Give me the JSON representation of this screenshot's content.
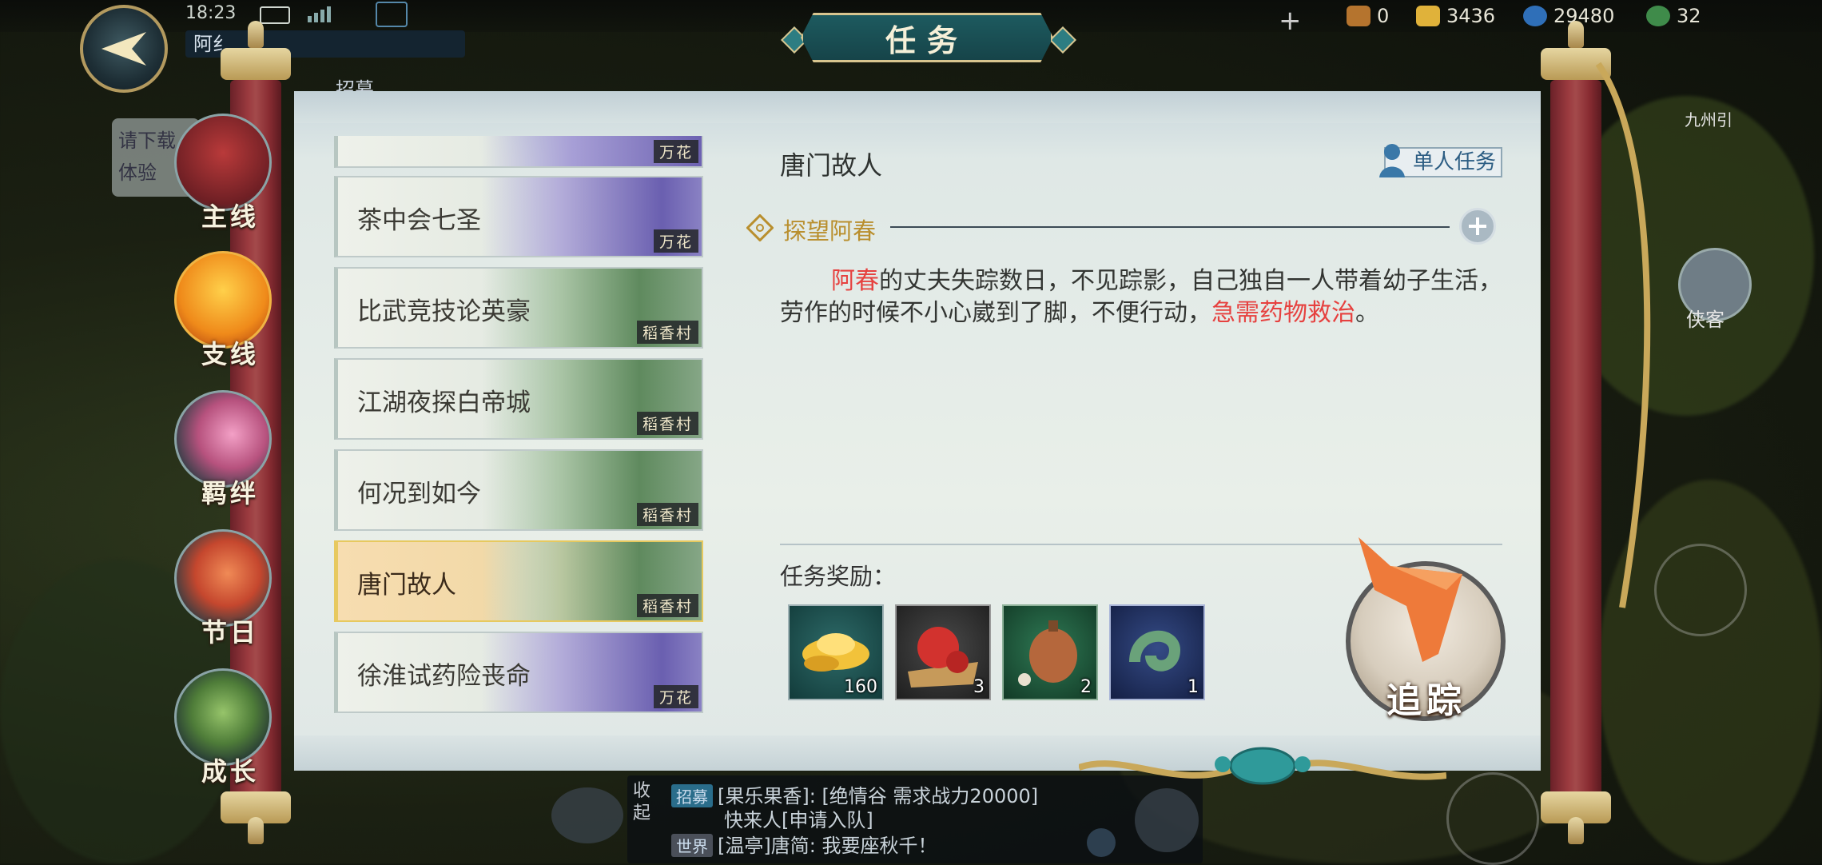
{
  "status_bar": {
    "time": "18:23",
    "battery_level": "30"
  },
  "top_resources": {
    "gold": "3436",
    "coins": "29480",
    "jade_partial": "32",
    "other": "0"
  },
  "player_name_partial": "阿纟",
  "tip_text": [
    "请下载",
    "体验"
  ],
  "recruit_label": "招募",
  "panel_title": "任务",
  "categories": [
    {
      "label": "主线",
      "active": false
    },
    {
      "label": "支线",
      "active": true
    },
    {
      "label": "羁绊",
      "active": false
    },
    {
      "label": "节日",
      "active": false
    },
    {
      "label": "成长",
      "active": false
    }
  ],
  "quests": [
    {
      "title": "",
      "location": "万花",
      "scene": "purple"
    },
    {
      "title": "茶中会七圣",
      "location": "万花",
      "scene": "purple"
    },
    {
      "title": "比武竞技论英豪",
      "location": "稻香村",
      "scene": "green"
    },
    {
      "title": "江湖夜探白帝城",
      "location": "稻香村",
      "scene": "green"
    },
    {
      "title": "何况到如今",
      "location": "稻香村",
      "scene": "green"
    },
    {
      "title": "唐门故人",
      "location": "稻香村",
      "scene": "green",
      "active": true
    },
    {
      "title": "徐淮试药险丧命",
      "location": "万花",
      "scene": "purple"
    }
  ],
  "detail": {
    "title": "唐门故人",
    "badge": "单人任务",
    "objective": "探望阿春",
    "desc_name": "阿春",
    "desc_mid": "的丈夫失踪数日，不见踪影，自己独自一人带着幼子生活，劳作的时候不小心崴到了脚，不便行动，",
    "desc_urgent": "急需药物救治",
    "desc_end": "。",
    "reward_label": "任务奖励：",
    "rewards": [
      {
        "name": "gold-ingot",
        "qty": "160",
        "bg": "#123b3a"
      },
      {
        "name": "red-fruit",
        "qty": "3",
        "bg": "#2a2a2a"
      },
      {
        "name": "lantern-gourd",
        "qty": "2",
        "bg": "#1d4a35"
      },
      {
        "name": "jade-pendant",
        "qty": "1",
        "bg": "#1a2a52"
      }
    ],
    "track_label": "追踪"
  },
  "right_side": {
    "label_1": "侠客",
    "label_2": "九州引"
  },
  "chat": {
    "fold_label": "收起",
    "line1_tag": "招募",
    "line1": "[果乐果香]: [绝情谷 需求战力20000]",
    "line2": "快来人[申请入队]",
    "line3_tag": "世界",
    "line3": "[温亭]唐简: 我要座秋千！"
  },
  "colors": {
    "accent_red": "#e6413f",
    "gold_text": "#b98f2e",
    "teal_banner": "#1d5a5f"
  }
}
